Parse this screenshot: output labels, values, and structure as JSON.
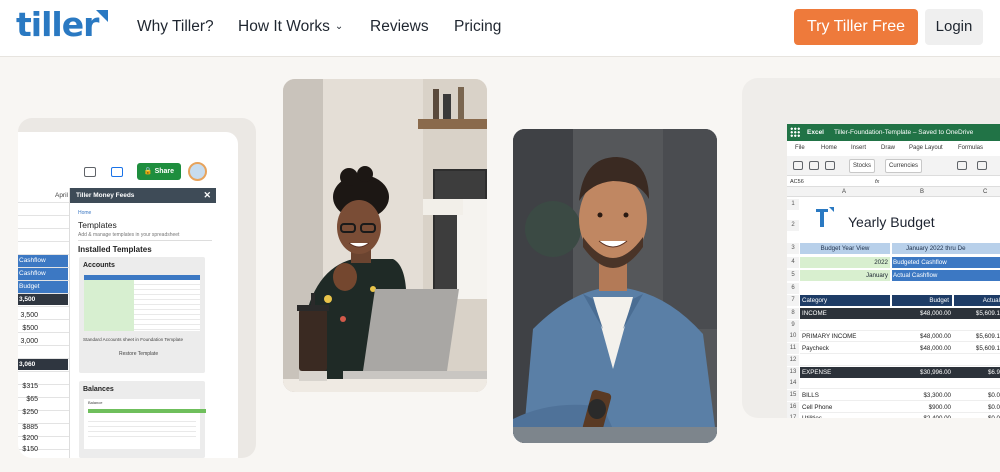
{
  "colors": {
    "brand_blue": "#2a79c2",
    "cta_orange": "#ee7a3b",
    "share_green": "#1e8e3e",
    "sheet_blue": "#3c78c3",
    "excel_green": "#217346",
    "excel_light_blue": "#b8d0ea",
    "excel_dark": "#2c323a",
    "excel_navy": "#1e3c66"
  },
  "header": {
    "logo_text": "tiller",
    "nav": [
      {
        "label": "Why Tiller?"
      },
      {
        "label": "How It Works",
        "icon": "chevron-down-icon"
      },
      {
        "label": "Reviews"
      },
      {
        "label": "Pricing"
      }
    ],
    "cta_label": "Try Tiller Free",
    "login_label": "Login"
  },
  "left_card": {
    "share_label": "Share",
    "column_header": "April",
    "blue_rows": [
      "Cashflow",
      "Cashflow",
      "Budget"
    ],
    "values_a": [
      "3,500"
    ],
    "values_b": [
      "3,500",
      "$500",
      "3,000"
    ],
    "values_c": [
      "3,060"
    ],
    "values_d": [
      "$315",
      "$65",
      "$250"
    ],
    "values_e": [
      "$885",
      "$200",
      "$150"
    ],
    "panel": {
      "title": "Tiller Money Feeds",
      "home_link": "Home",
      "heading": "Templates",
      "subheading": "Add & manage templates in your spreadsheet",
      "installed": "Installed Templates",
      "accounts_title": "Accounts",
      "accounts_caption": "Standard Accounts sheet in Foundation Template",
      "restore_label": "Restore Template",
      "balances_title": "Balances",
      "balance_label": "Balance"
    }
  },
  "right_card": {
    "app_name": "Excel",
    "file_name": "Tiller-Foundation-Template  –  Saved to OneDrive",
    "menu": [
      "File",
      "Home",
      "Insert",
      "Draw",
      "Page Layout",
      "Formulas"
    ],
    "tools": {
      "stocks": "Stocks",
      "currencies": "Currencies"
    },
    "name_box": "AC56",
    "fx": "fx",
    "columns": [
      "A",
      "B",
      "C"
    ],
    "title": "Yearly Budget",
    "budget_year_view": "Budget Year View",
    "budget_period": "January 2022 thru De",
    "year": "2022",
    "budgeted_label": "Budgeted Cashflow",
    "month": "January",
    "actual_label": "Actual Cashflow",
    "table_header": {
      "category": "Category",
      "budget": "Budget",
      "actual": "Actual"
    },
    "rows": [
      {
        "num": "8",
        "category": "INCOME",
        "budget": "$48,000.00",
        "actual": "$5,609.1",
        "style": "dark"
      },
      {
        "num": "9",
        "category": "",
        "budget": "",
        "actual": "",
        "style": "plain"
      },
      {
        "num": "10",
        "category": "PRIMARY INCOME",
        "budget": "$48,000.00",
        "actual": "$5,609.1",
        "style": "plain"
      },
      {
        "num": "11",
        "category": "Paycheck",
        "budget": "$48,000.00",
        "actual": "$5,609.1",
        "style": "plain"
      },
      {
        "num": "12",
        "category": "",
        "budget": "",
        "actual": "",
        "style": "plain"
      },
      {
        "num": "13",
        "category": "EXPENSE",
        "budget": "$30,996.00",
        "actual": "$6.9",
        "style": "dark"
      },
      {
        "num": "14",
        "category": "",
        "budget": "",
        "actual": "",
        "style": "plain"
      },
      {
        "num": "15",
        "category": "BILLS",
        "budget": "$3,300.00",
        "actual": "$0.0",
        "style": "plain"
      },
      {
        "num": "16",
        "category": "Cell Phone",
        "budget": "$900.00",
        "actual": "$0.0",
        "style": "plain"
      },
      {
        "num": "17",
        "category": "Utilities",
        "budget": "$2,400.00",
        "actual": "$0.0",
        "style": "plain"
      }
    ]
  }
}
